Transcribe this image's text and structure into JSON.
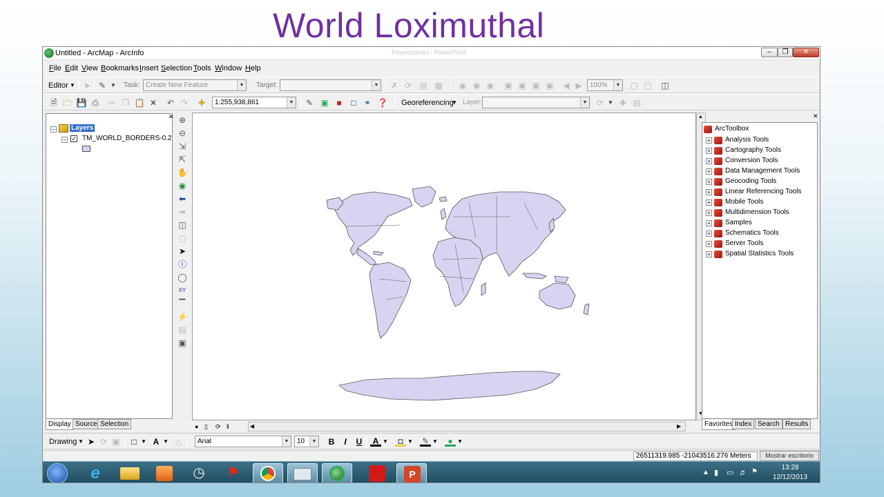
{
  "slide_title": "World Loximuthal",
  "window": {
    "title": "Untitled - ArcMap - ArcInfo",
    "ghost_title": "Proyecciones - PowerPoint"
  },
  "menu": [
    "File",
    "Edit",
    "View",
    "Bookmarks",
    "Insert",
    "Selection",
    "Tools",
    "Window",
    "Help"
  ],
  "editor_toolbar": {
    "editor_label": "Editor",
    "task_label": "Task:",
    "task_value": "Create New Feature",
    "target_label": "Target:",
    "target_value": "",
    "zoom_value": "100%"
  },
  "standard_toolbar": {
    "scale_value": "1:255,938,861",
    "georef_label": "Georeferencing",
    "layer_label": "Layer:",
    "layer_value": ""
  },
  "toc": {
    "root_label": "Layers",
    "layer_name": "TM_WORLD_BORDERS-0.2",
    "layer_checked": true,
    "symbol_color": "#d9d2f0",
    "tabs": [
      "Display",
      "Source",
      "Selection"
    ]
  },
  "toolbox": {
    "root_label": "ArcToolbox",
    "items": [
      "Analysis Tools",
      "Cartography Tools",
      "Conversion Tools",
      "Data Management Tools",
      "Geocoding Tools",
      "Linear Referencing Tools",
      "Mobile Tools",
      "Multidimension Tools",
      "Samples",
      "Schematics Tools",
      "Server Tools",
      "Spatial Statistics Tools"
    ],
    "tabs": [
      "Favorites",
      "Index",
      "Search",
      "Results"
    ]
  },
  "map": {
    "fill_color": "#d9d2f0",
    "stroke_color": "#555555"
  },
  "drawing_toolbar": {
    "drawing_label": "Drawing",
    "font_value": "Arial",
    "size_value": "10",
    "bold": "B",
    "italic": "I",
    "underline": "U",
    "font_color_glyph": "A"
  },
  "status": {
    "coords": "26511319.985  -21043516.276 Meters",
    "desktop_button": "Mostrar escritorio"
  },
  "taskbar": {
    "time": "13:28",
    "date": "12/12/2013"
  }
}
